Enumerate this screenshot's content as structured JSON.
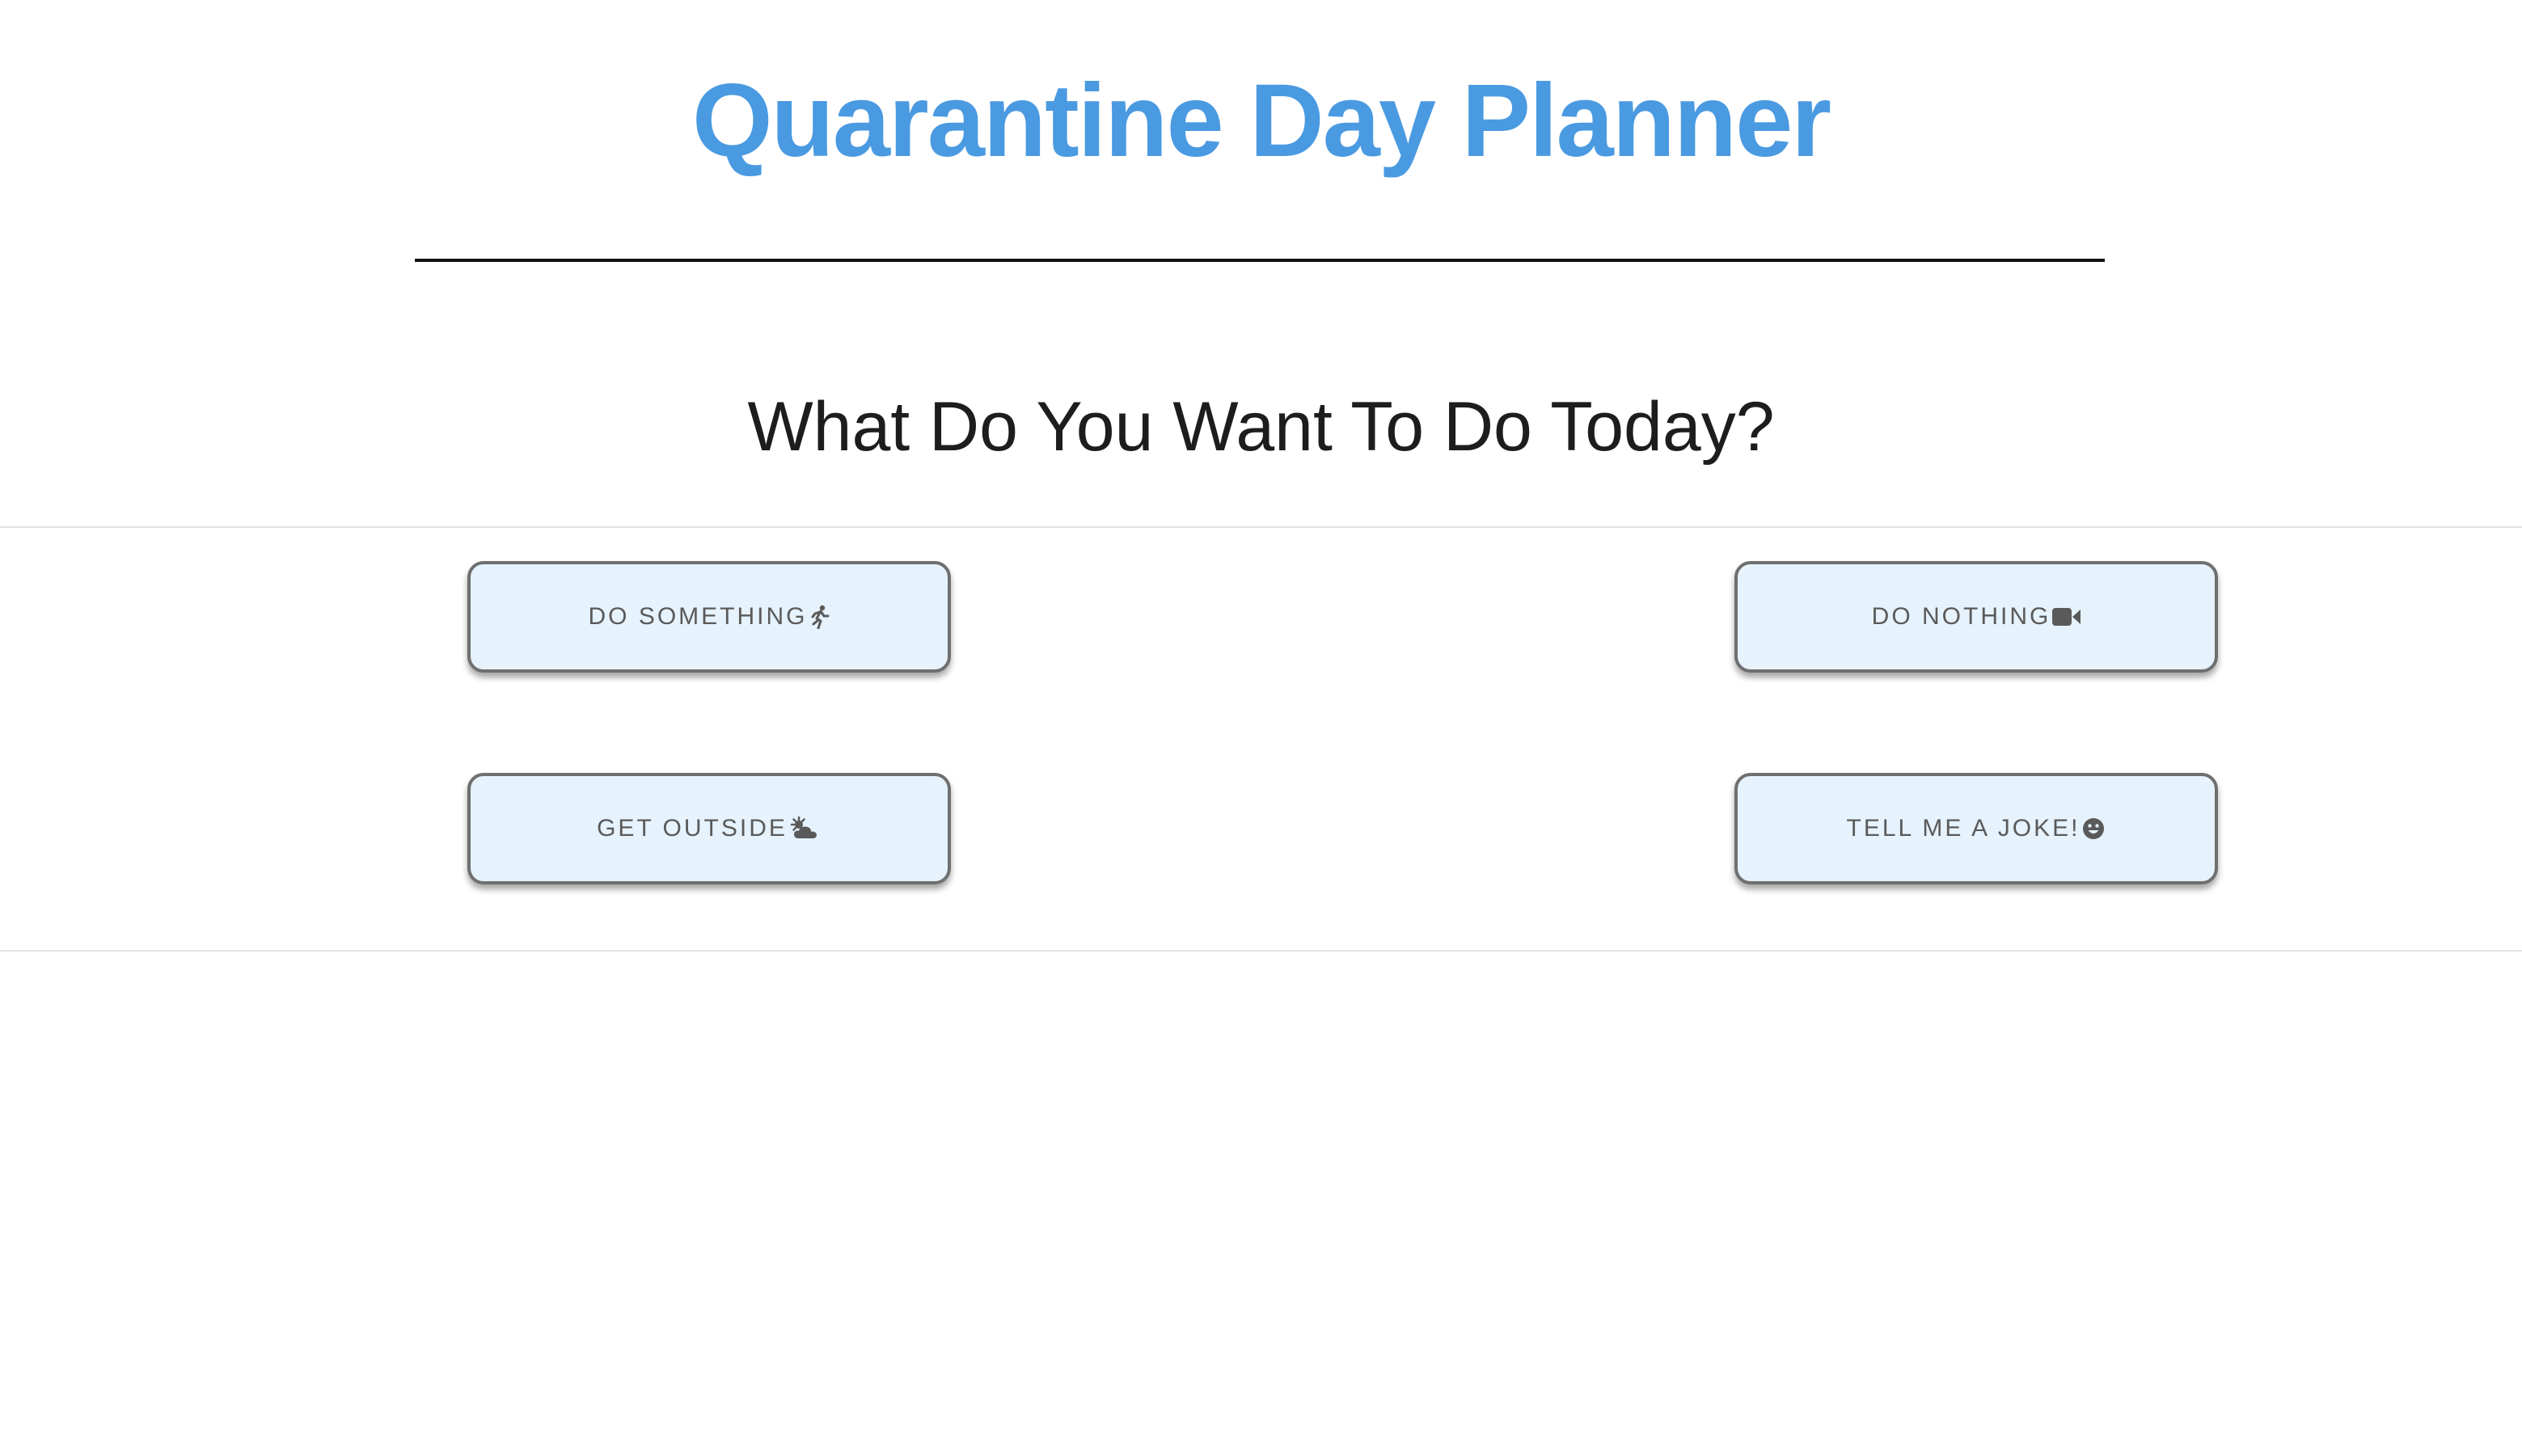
{
  "header": {
    "title": "Quarantine Day Planner",
    "subtitle": "What Do You Want To Do Today?"
  },
  "buttons": [
    {
      "label": "DO SOMETHING",
      "icon": "running-person-icon"
    },
    {
      "label": "DO NOTHING",
      "icon": "video-camera-icon"
    },
    {
      "label": "GET OUTSIDE",
      "icon": "sun-behind-cloud-icon"
    },
    {
      "label": "TELL ME A JOKE!",
      "icon": "smiling-face-icon"
    }
  ],
  "colors": {
    "title": "#4a9ae1",
    "button_background": "#e6f2fc",
    "button_border": "#6f6f6f",
    "button_text": "#5a5a5a"
  }
}
